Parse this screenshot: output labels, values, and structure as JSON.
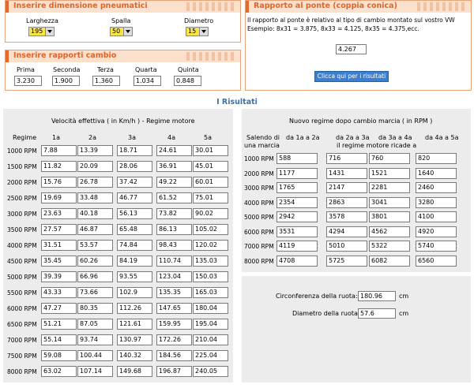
{
  "tyres": {
    "title": "Inserire dimensione pneumatici",
    "width_label": "Larghezza",
    "width_value": "195",
    "shoulder_label": "Spalla",
    "shoulder_value": "50",
    "diameter_label": "Diametro",
    "diameter_value": "15"
  },
  "gears": {
    "title": "Inserire rapporti cambio",
    "labels": [
      "Prima",
      "Seconda",
      "Terza",
      "Quarta",
      "Quinta"
    ],
    "values": [
      "3.230",
      "1.900",
      "1.360",
      "1.034",
      "0.848"
    ]
  },
  "axle": {
    "title": "Rapporto al ponte (coppia conica)",
    "desc1": "Il rapporto al ponte è relativo al tipo di cambio montato sul vostro VW",
    "desc2": "Esempio: 8x31 = 3.875, 8x33 = 4.125, 8x35 = 4.375,ecc.",
    "value": "4.267",
    "button": "Clicca qui per i risultati"
  },
  "results_title": "I Risultati",
  "speed": {
    "title": "Velocità effettiva ( in Km/h ) - Regime motore",
    "regime_header": "Regime",
    "columns": [
      "1a",
      "2a",
      "3a",
      "4a",
      "5a"
    ],
    "rows": [
      {
        "rpm": "1000 RPM",
        "v": [
          "7.88",
          "13.39",
          "18.71",
          "24.61",
          "30.01"
        ]
      },
      {
        "rpm": "1500 RPM",
        "v": [
          "11.82",
          "20.09",
          "28.06",
          "36.91",
          "45.01"
        ]
      },
      {
        "rpm": "2000 RPM",
        "v": [
          "15.76",
          "26.78",
          "37.42",
          "49.22",
          "60.01"
        ]
      },
      {
        "rpm": "2500 RPM",
        "v": [
          "19.69",
          "33.48",
          "46.77",
          "61.52",
          "75.01"
        ]
      },
      {
        "rpm": "3000 RPM",
        "v": [
          "23.63",
          "40.18",
          "56.13",
          "73.82",
          "90.02"
        ]
      },
      {
        "rpm": "3500 RPM",
        "v": [
          "27.57",
          "46.87",
          "65.48",
          "86.13",
          "105.02"
        ]
      },
      {
        "rpm": "4000 RPM",
        "v": [
          "31.51",
          "53.57",
          "74.84",
          "98.43",
          "120.02"
        ]
      },
      {
        "rpm": "4500 RPM",
        "v": [
          "35.45",
          "60.26",
          "84.19",
          "110.74",
          "135.03"
        ]
      },
      {
        "rpm": "5000 RPM",
        "v": [
          "39.39",
          "66.96",
          "93.55",
          "123.04",
          "150.03"
        ]
      },
      {
        "rpm": "5500 RPM",
        "v": [
          "43.33",
          "73.66",
          "102.9",
          "135.35",
          "165.03"
        ]
      },
      {
        "rpm": "6000 RPM",
        "v": [
          "47.27",
          "80.35",
          "112.26",
          "147.65",
          "180.04"
        ]
      },
      {
        "rpm": "6500 RPM",
        "v": [
          "51.21",
          "87.05",
          "121.61",
          "159.95",
          "195.04"
        ]
      },
      {
        "rpm": "7000 RPM",
        "v": [
          "55.14",
          "93.74",
          "130.97",
          "172.26",
          "210.04"
        ]
      },
      {
        "rpm": "7500 RPM",
        "v": [
          "59.08",
          "100.44",
          "140.32",
          "184.56",
          "225.04"
        ]
      },
      {
        "rpm": "8000 RPM",
        "v": [
          "63.02",
          "107.14",
          "149.68",
          "196.87",
          "240.05"
        ]
      }
    ]
  },
  "shift": {
    "title": "Nuovo regime dopo cambio marcia ( in RPM )",
    "first_header_1": "Salendo di",
    "first_header_2": "una marcia",
    "columns": [
      "da 1a a 2a",
      "da 2a a 3a",
      "da 3a a 4a",
      "da 4a a 5a"
    ],
    "subheader": "il regime motore ricade a",
    "rows": [
      {
        "rpm": "1000 RPM",
        "v": [
          "588",
          "716",
          "760",
          "820"
        ]
      },
      {
        "rpm": "2000 RPM",
        "v": [
          "1177",
          "1431",
          "1521",
          "1640"
        ]
      },
      {
        "rpm": "3000 RPM",
        "v": [
          "1765",
          "2147",
          "2281",
          "2460"
        ]
      },
      {
        "rpm": "4000 RPM",
        "v": [
          "2354",
          "2863",
          "3041",
          "3280"
        ]
      },
      {
        "rpm": "5000 RPM",
        "v": [
          "2942",
          "3578",
          "3801",
          "4100"
        ]
      },
      {
        "rpm": "6000 RPM",
        "v": [
          "3531",
          "4294",
          "4562",
          "4920"
        ]
      },
      {
        "rpm": "7000 RPM",
        "v": [
          "4119",
          "5010",
          "5322",
          "5740"
        ]
      },
      {
        "rpm": "8000 RPM",
        "v": [
          "4708",
          "5725",
          "6082",
          "6560"
        ]
      }
    ]
  },
  "wheel": {
    "circ_label": "Circonferenza della ruota:",
    "circ_value": "180.96",
    "circ_unit": "cm",
    "diam_label": "Diametro della ruota:",
    "diam_value": "57.6",
    "diam_unit": "cm"
  }
}
